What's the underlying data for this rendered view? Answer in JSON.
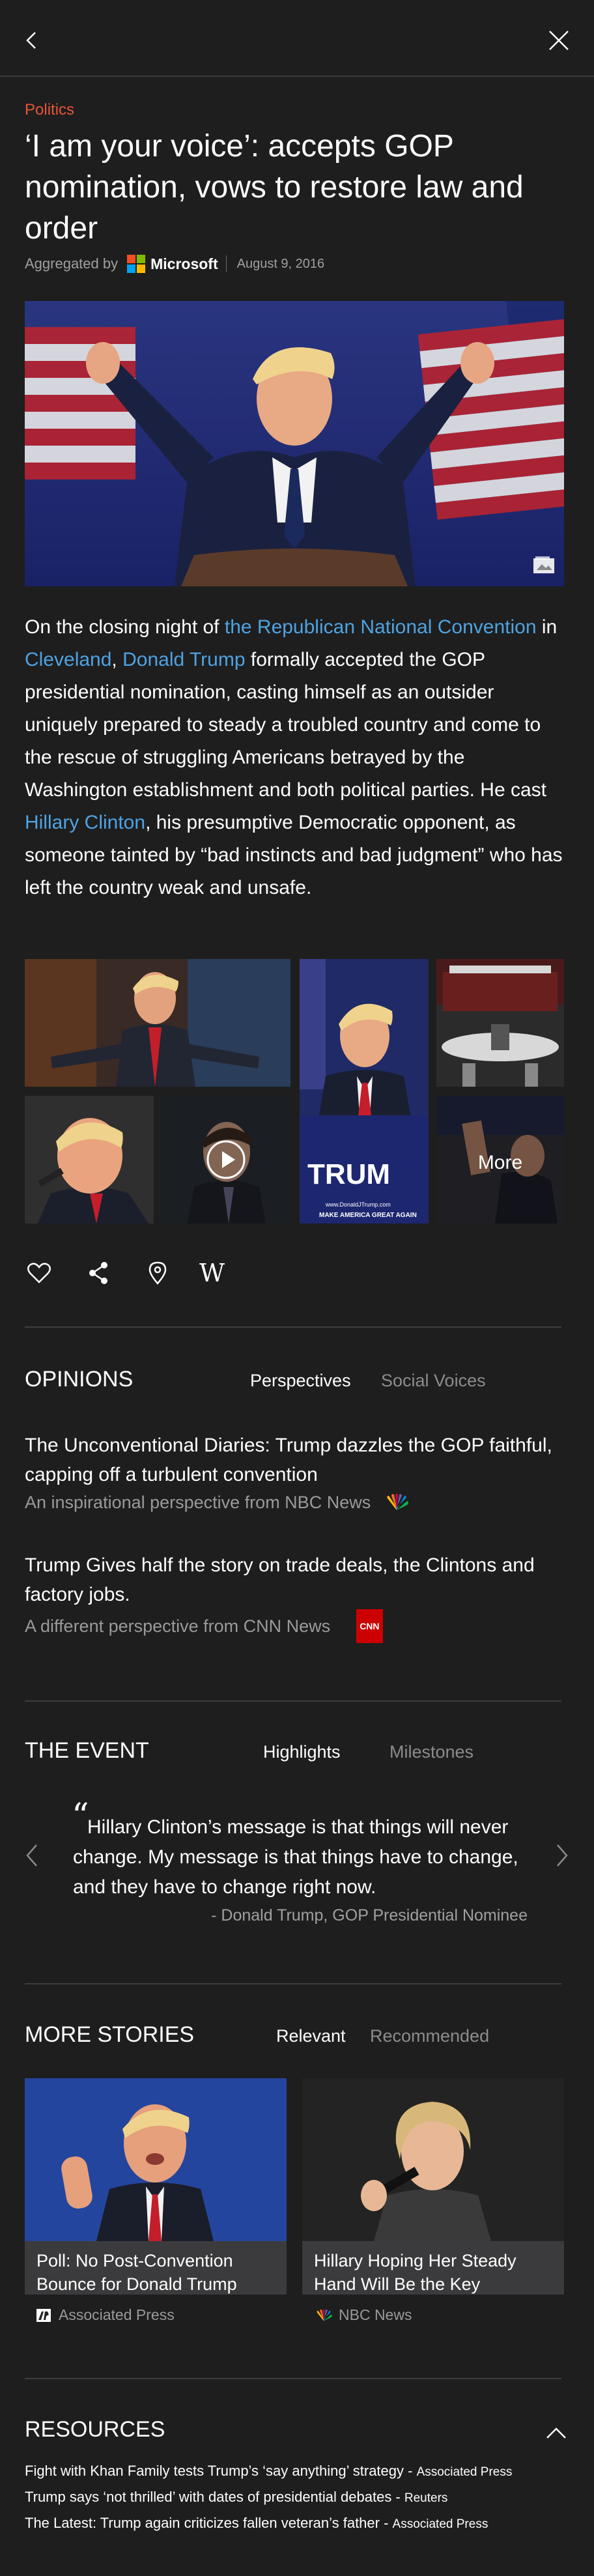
{
  "nav": {
    "back_icon": "chevron-left-icon",
    "close_icon": "close-icon"
  },
  "article": {
    "category": "Politics",
    "headline": "‘I am your voice’: accepts GOP nomination, vows to restore law and order",
    "aggregated_by": "Aggregated by",
    "provider": "Microsoft",
    "date": "August 9, 2016",
    "hero_image": "Donald Trump giving two thumbs up in front of American flags",
    "body": {
      "p1": "On the closing night of ",
      "link1": "the Republican National Convention",
      "p2": " in ",
      "link2": "Cleveland",
      "p3": ", ",
      "link3": "Donald Trump",
      "p4": " formally accepted the GOP presidential nomination, casting himself as an outsider uniquely prepared to steady a troubled country and come to the rescue of struggling Americans betrayed by the Washington establishment and both political parties. He cast ",
      "link4": "Hillary Clinton",
      "p5": ", his presumptive Democratic opponent, as someone tainted by “bad instincts and bad judgment” who has left the country weak and unsafe."
    }
  },
  "gallery": {
    "more_label": "More",
    "sign_text": "TRUM",
    "sign_subtext": "MAKE AMERICA GREAT AGAIN",
    "sign_url": "www.DonaldJTrump.com"
  },
  "actions": {
    "like_icon": "heart-icon",
    "share_icon": "share-icon",
    "location_icon": "map-pin-icon",
    "wiki_icon": "wikipedia-icon",
    "wiki_glyph": "W"
  },
  "opinions": {
    "title": "OPINIONS",
    "tabs": [
      "Perspectives",
      "Social Voices"
    ],
    "items": [
      {
        "title": "The Unconventional Diaries: Trump dazzles the GOP faithful, capping off a turbulent convention",
        "desc": "An inspirational perspective from NBC News",
        "logo": "nbc-peacock-icon"
      },
      {
        "title": "Trump Gives half the story on trade deals, the Clintons and factory jobs.",
        "desc": "A different perspective from CNN News",
        "logo": "cnn-logo-icon",
        "logo_text": "CNN"
      }
    ]
  },
  "event": {
    "title": "THE EVENT",
    "tabs": [
      "Highlights",
      "Milestones"
    ],
    "quote_mark": "“",
    "quote": "Hillary Clinton’s message is that things will never change. My message is that things have to change, and they have to change right now.",
    "attribution": "- Donald Trump, GOP Presidential Nominee"
  },
  "more_stories": {
    "title": "MORE STORIES",
    "tabs": [
      "Relevant",
      "Recommended"
    ],
    "cards": [
      {
        "title": "Poll: No Post-Convention Bounce for Donald Trump",
        "source": "Associated Press",
        "source_icon": "ap-logo-icon",
        "image": "Donald Trump speaking and gesturing"
      },
      {
        "title": "Hillary Hoping Her Steady Hand Will Be the Key",
        "source": "NBC News",
        "source_icon": "nbc-peacock-icon",
        "image": "Hillary Clinton at a microphone"
      }
    ]
  },
  "resources": {
    "title": "RESOURCES",
    "collapse_icon": "chevron-up-icon",
    "items": [
      {
        "text": "Fight with Khan Family tests Trump’s ‘say anything’ strategy - ",
        "source": "Associated Press"
      },
      {
        "text": "Trump says ‘not thrilled’ with dates of presidential debates - ",
        "source": "Reuters"
      },
      {
        "text": "The Latest: Trump again criticizes fallen veteran’s father - ",
        "source": "Associated Press"
      }
    ]
  },
  "colors": {
    "background": "#1e1e1e",
    "accent_red": "#e8553a",
    "link_blue": "#4ea3e3",
    "muted_text": "#9a9a9a",
    "card_bg": "#3b3b3d",
    "divider": "#3d3d3d"
  }
}
